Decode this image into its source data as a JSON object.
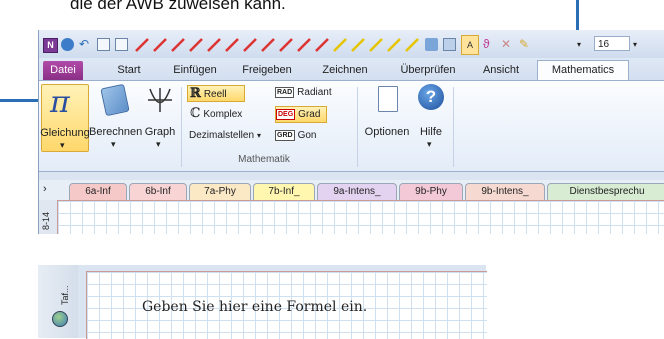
{
  "caption": "die der AWB zuweisen kann.",
  "toolbar": {
    "font_size": "16"
  },
  "ribbon_tabs": [
    "Datei",
    "Start",
    "Einfügen",
    "Freigeben",
    "Zeichnen",
    "Überprüfen",
    "Ansicht",
    "Mathematics"
  ],
  "active_tab": "Mathematics",
  "buttons": {
    "gleichung": "Gleichung",
    "berechnen": "Berechnen",
    "graph": "Graph",
    "optionen": "Optionen",
    "hilfe": "Hilfe"
  },
  "options": {
    "reell": "Reell",
    "komplex": "Komplex",
    "dezimalstellen": "Dezimalstellen",
    "radiant_badge": "RAD",
    "radiant": "Radiant",
    "grad_badge": "DEG",
    "grad": "Grad",
    "gon_badge": "GRD",
    "gon": "Gon"
  },
  "group_label": "Mathematik",
  "section_tabs": [
    {
      "label": "6a-Inf",
      "color": "#f6c9c9"
    },
    {
      "label": "6b-Inf",
      "color": "#f8d4d4"
    },
    {
      "label": "7a-Phy",
      "color": "#fbe9c6"
    },
    {
      "label": "7b-Inf_",
      "color": "#fff7b0"
    },
    {
      "label": "9a-Intens_",
      "color": "#e3d3f0"
    },
    {
      "label": "9b-Phy",
      "color": "#f3c9d8"
    },
    {
      "label": "9b-Intens_",
      "color": "#f6d9d0"
    },
    {
      "label": "Dienstbesprechu",
      "color": "#d7ecd3"
    }
  ],
  "side_label_top": "8-14",
  "side_label_bottom": "Taf...",
  "formula_hint": "Geben Sie hier eine Formel ein.",
  "colors": {
    "accent": "#2a6fb5",
    "datei": "#9b3d96"
  }
}
